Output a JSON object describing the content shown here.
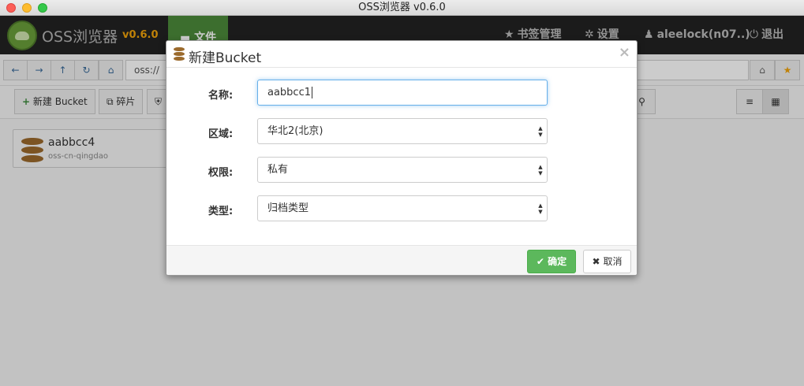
{
  "window": {
    "title": "OSS浏览器 v0.6.0"
  },
  "navbar": {
    "brand": "OSS浏览器",
    "version": "v0.6.0",
    "file_tab": "文件",
    "bookmarks": "书签管理",
    "settings": "设置",
    "user": "aleelock(n07..)",
    "logout": "退出"
  },
  "address_bar": {
    "value": "oss://"
  },
  "toolbar": {
    "new_bucket": "新建 Bucket",
    "fragments": "碎片"
  },
  "buckets": [
    {
      "name": "aabbcc4",
      "region": "oss-cn-qingdao"
    }
  ],
  "modal": {
    "title": "新建Bucket",
    "close": "×",
    "name_label": "名称:",
    "name_value": "aabbcc1",
    "region_label": "区域:",
    "region_value": "华北2(北京)",
    "acl_label": "权限:",
    "acl_value": "私有",
    "type_label": "类型:",
    "type_value": "归档类型",
    "ok": "确定",
    "cancel": "取消"
  },
  "colors": {
    "navbar": "#222222",
    "active_tab": "#4c8a3a",
    "version": "#f0a30a",
    "ok_button": "#5cb85c",
    "bucket_icon": "#9b6a2c"
  }
}
